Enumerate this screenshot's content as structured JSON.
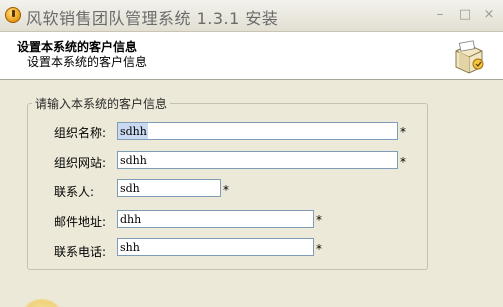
{
  "window": {
    "title": "风软销售团队管理系统 1.3.1 安装",
    "minimize_glyph": "–",
    "maximize_glyph": "□",
    "close_glyph": "×"
  },
  "header": {
    "title": "设置本系统的客户信息",
    "subtitle": "设置本系统的客户信息",
    "icon": "installer-box-icon"
  },
  "group": {
    "legend": "请输入本系统的客户信息",
    "fields": [
      {
        "label": "组织名称:",
        "value": "sdhh",
        "required": "*",
        "selected": true
      },
      {
        "label": "组织网站:",
        "value": "sdhh",
        "required": "*"
      },
      {
        "label": "联系人:",
        "value": "sdh",
        "required": "*"
      },
      {
        "label": "邮件地址:",
        "value": "dhh",
        "required": "*"
      },
      {
        "label": "联系电话:",
        "value": "shh",
        "required": "*"
      }
    ]
  },
  "colors": {
    "dialog_bg": "#ece9d8",
    "input_border": "#7f9db9",
    "selection": "#c9d9f1"
  }
}
